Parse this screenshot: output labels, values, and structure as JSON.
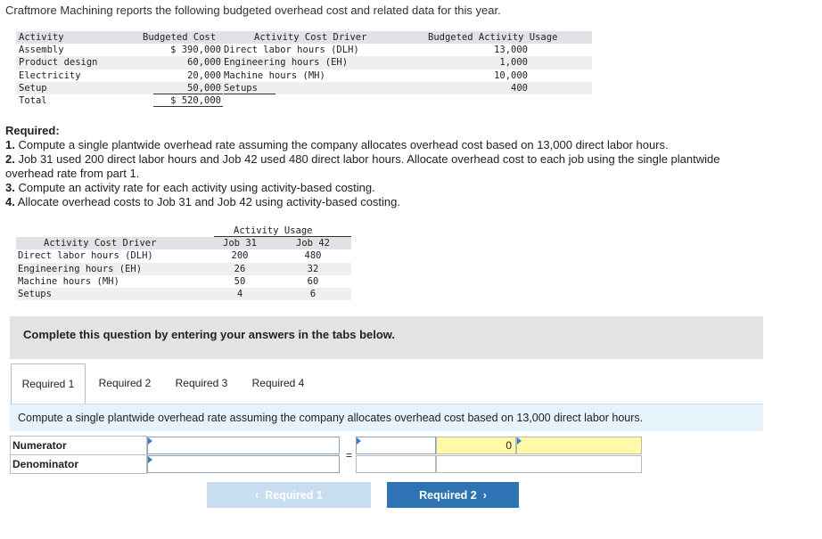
{
  "intro": "Craftmore Machining reports the following budgeted overhead cost and related data for this year.",
  "budget_table": {
    "headers": {
      "activity": "Activity",
      "cost": "Budgeted Cost",
      "driver": "Activity Cost Driver",
      "usage": "Budgeted Activity Usage"
    },
    "rows": [
      {
        "activity": "Assembly",
        "cost": "$ 390,000",
        "driver": "Direct labor hours (DLH)",
        "usage": "13,000"
      },
      {
        "activity": "Product design",
        "cost": "60,000",
        "driver": "Engineering hours (EH)",
        "usage": "1,000"
      },
      {
        "activity": "Electricity",
        "cost": "20,000",
        "driver": "Machine hours (MH)",
        "usage": "10,000"
      },
      {
        "activity": "Setup",
        "cost": "50,000",
        "driver": "Setups",
        "usage": "400"
      }
    ],
    "total": {
      "activity": "Total",
      "cost": "$ 520,000"
    }
  },
  "required": {
    "title": "Required:",
    "items": [
      {
        "num": "1.",
        "text": " Compute a single plantwide overhead rate assuming the company allocates overhead cost based on 13,000 direct labor hours."
      },
      {
        "num": "2.",
        "text": " Job 31 used 200 direct labor hours and Job 42 used 480 direct labor hours. Allocate overhead cost to each job using the single plantwide overhead rate from part 1."
      },
      {
        "num": "3.",
        "text": " Compute an activity rate for each activity using activity-based costing."
      },
      {
        "num": "4.",
        "text": " Allocate overhead costs to Job 31 and Job 42 using activity-based costing."
      }
    ]
  },
  "usage_table": {
    "group_header": "Activity Usage",
    "headers": {
      "driver": "Activity Cost Driver",
      "job31": "Job 31",
      "job42": "Job 42"
    },
    "rows": [
      {
        "driver": "Direct labor hours (DLH)",
        "job31": "200",
        "job42": "480"
      },
      {
        "driver": "Engineering hours (EH)",
        "job31": "26",
        "job42": "32"
      },
      {
        "driver": "Machine hours (MH)",
        "job31": "50",
        "job42": "60"
      },
      {
        "driver": "Setups",
        "job31": "4",
        "job42": "6"
      }
    ]
  },
  "banner": "Complete this question by entering your answers in the tabs below.",
  "tabs": [
    "Required 1",
    "Required 2",
    "Required 3",
    "Required 4"
  ],
  "active_tab": "Required 1",
  "instruction": "Compute a single plantwide overhead rate assuming the company allocates overhead cost based on 13,000 direct labor hours.",
  "calc": {
    "numerator_label": "Numerator",
    "denominator_label": "Denominator",
    "numerator_value": "",
    "denominator_value": "",
    "rate_value": "",
    "equals": "=",
    "result": "0"
  },
  "nav": {
    "prev": "Required 1",
    "next": "Required 2"
  },
  "colors": {
    "accent": "#2e74b5",
    "disabled": "#c9ddf1",
    "result_bg": "#fff9a8",
    "banner_bg": "#e3e3e3",
    "instr_bg": "#e6f3fb"
  }
}
